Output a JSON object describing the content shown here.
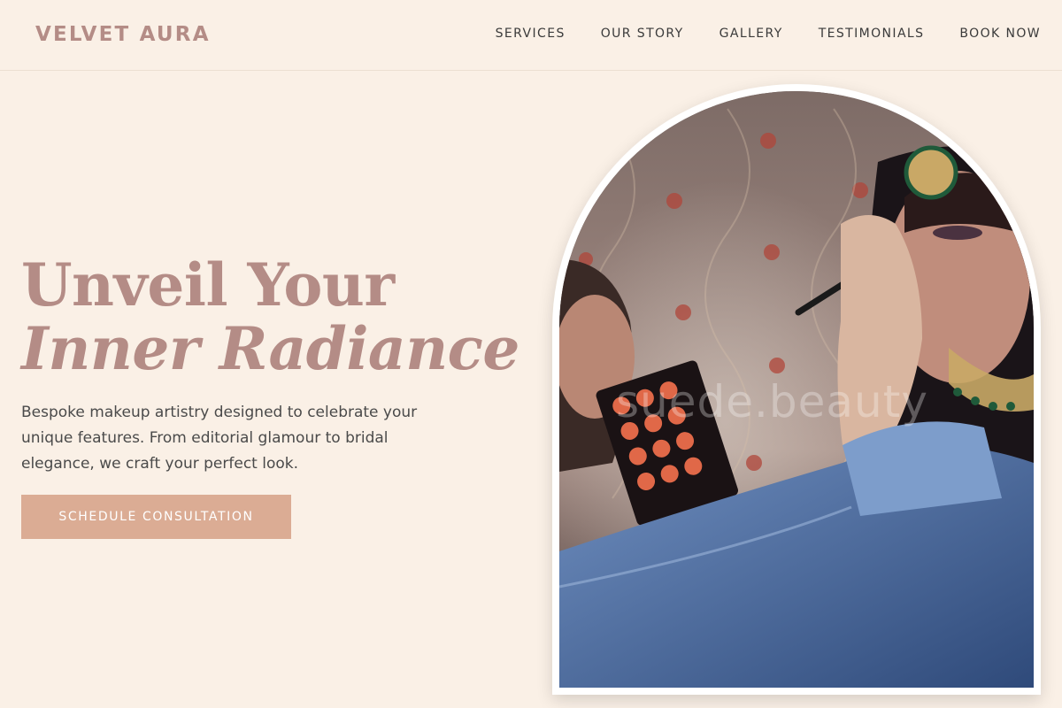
{
  "header": {
    "brand": "VELVET AURA",
    "nav": [
      "SERVICES",
      "OUR STORY",
      "GALLERY",
      "TESTIMONIALS",
      "BOOK NOW"
    ]
  },
  "hero": {
    "title_line1": "Unveil Your",
    "title_line2": "Inner Radiance",
    "description": "Bespoke makeup artistry designed to celebrate your unique features. From editorial glamour to bridal elegance, we craft your perfect look.",
    "cta_label": "SCHEDULE CONSULTATION",
    "image_watermark": "suede.beauty"
  },
  "colors": {
    "background": "#faf0e6",
    "brand": "#b48c86",
    "cta": "#dbac94",
    "text": "#4a4a4a"
  }
}
